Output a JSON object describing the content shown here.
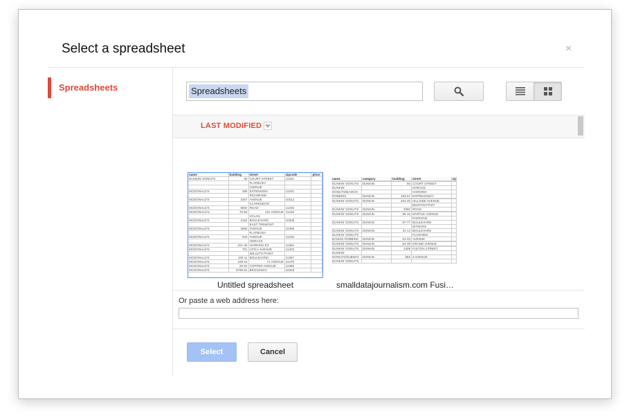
{
  "dialog": {
    "title": "Select a spreadsheet",
    "close_glyph": "×"
  },
  "sidebar": {
    "items": [
      {
        "label": "Spreadsheets",
        "active": true
      }
    ]
  },
  "search": {
    "query_token": "Spreadsheets",
    "search_icon": "magnifier-icon"
  },
  "view_toggle": {
    "list_icon": "list-view-icon",
    "grid_icon": "grid-view-icon",
    "selected": "grid"
  },
  "sort": {
    "label": "LAST MODIFIED",
    "arrow_icon": "dropdown-arrow-icon"
  },
  "files": [
    {
      "name": "Untitled spreadsheet",
      "selected": true,
      "preview": {
        "headers": [
          "name",
          "building",
          "street",
          "zipcode",
          "phon"
        ],
        "rows": [
          [
            "DUNKIN' DONUTS",
            "50",
            "COURT STREET",
            "11201",
            ""
          ],
          [
            "",
            "",
            "FLATBUSH",
            "",
            ""
          ],
          [
            "",
            "",
            "AVENUE",
            "",
            ""
          ],
          [
            "MCDONALD'S",
            "395",
            "EXTENSION",
            "11201",
            ""
          ],
          [
            "",
            "",
            "RICHMOND",
            "",
            ""
          ],
          [
            "MCDONALD'S",
            "3267",
            "AVENUE",
            "10312",
            ""
          ],
          [
            "",
            "",
            "CLARENDON",
            "",
            ""
          ],
          [
            "MCDONALD'S",
            "5804",
            "ROAD",
            "11203",
            ""
          ],
          [
            "MCDONALD'S",
            "75-50",
            "101 AVENUE",
            "11416",
            ""
          ],
          [
            "",
            "",
            "HYLAN",
            "",
            ""
          ],
          [
            "MCDONALD'S",
            "2154",
            "BOULEVARD",
            "10306",
            ""
          ],
          [
            "",
            "",
            "EAST TREMONT",
            "",
            ""
          ],
          [
            "MCDONALD'S",
            "3660",
            "AVENUE",
            "10465",
            ""
          ],
          [
            "",
            "",
            "FLATBUSH",
            "",
            ""
          ],
          [
            "MCDONALD'S",
            "943",
            "AVENUE",
            "11226",
            ""
          ],
          [
            "",
            "",
            "HORACE",
            "",
            ""
          ],
          [
            "MCDONALD'S",
            "221-28",
            "HARDING EX",
            "11364",
            ""
          ],
          [
            "MCDONALD'S",
            "701",
            "UTICA AVENUE",
            "11203",
            ""
          ],
          [
            "",
            "",
            "WILLETS POINT",
            "",
            ""
          ],
          [
            "MCDONALD'S",
            "150-11",
            "BOULEVARD",
            "11357",
            ""
          ],
          [
            "MCDONALD'S",
            "108-15",
            "71 AVENUE",
            "11375",
            ""
          ],
          [
            "MCDONALD'S",
            "20-02",
            "COPPER AVENUE",
            "11385",
            ""
          ],
          [
            "MCDONALD'S",
            "6798-81",
            "BROADWAY",
            "10463",
            ""
          ]
        ]
      }
    },
    {
      "name": "smalldatajournalism.com Fusi…",
      "selected": false,
      "preview": {
        "headers": [
          "name",
          "category",
          "building",
          "street",
          "zip"
        ],
        "rows": [
          [
            "",
            "",
            "",
            "",
            ""
          ],
          [
            "DUNKIN' DONUTS",
            "DUNKIN",
            "56",
            "COURT STREET",
            ""
          ],
          [
            "DUNKIN'",
            "",
            "",
            "HORACE",
            ""
          ],
          [
            "DONUTS/BASKIN",
            "",
            "",
            "HARDING",
            ""
          ],
          [
            "ROBBINS",
            "DUNKIN",
            "183-67",
            "EXPRESSWAY",
            ""
          ],
          [
            "",
            "",
            "",
            "",
            ""
          ],
          [
            "DUNKIN' DONUTS",
            "DUNKIN",
            "254-20",
            "HILLSIDE AVENUE",
            ""
          ],
          [
            "",
            "",
            "",
            "BOSTON POST",
            ""
          ],
          [
            "DUNKIN' DONUTS",
            "DUNKIN",
            "4080",
            "ROAD",
            ""
          ],
          [
            "",
            "",
            "",
            "",
            ""
          ],
          [
            "DUNKIN' DONUTS",
            "DUNKIN",
            "86-16",
            "MYRTLE AVENUE",
            ""
          ],
          [
            "",
            "",
            "",
            "PARSONS",
            ""
          ],
          [
            "DUNKIN' DONUTS",
            "DUNKIN",
            "97-77",
            "BOULEVARD",
            ""
          ],
          [
            "",
            "",
            "",
            "DITMARS",
            ""
          ],
          [
            "DUNKIN' DONUTS",
            "DUNKIN",
            "31-14",
            "BOULEVARD",
            ""
          ],
          [
            "DUNKIN' DONUTS",
            "",
            "",
            "FLUSHING",
            ""
          ],
          [
            "BASKIN ROBBINS",
            "DUNKIN",
            "61-03",
            "AVENUE",
            ""
          ],
          [
            "",
            "",
            "",
            "",
            ""
          ],
          [
            "DUNKIN' DONUTS",
            "DUNKIN",
            "64-38",
            "GRAND AVENUE",
            ""
          ],
          [
            "",
            "",
            "",
            "",
            ""
          ],
          [
            "DUNKIN' DONUTS",
            "DUNKIN",
            "1309",
            "FULTON STREET",
            ""
          ],
          [
            "DUNKIN'",
            "",
            "",
            "",
            ""
          ],
          [
            "DONUTS/SUBWAY",
            "DUNKIN",
            "582",
            "3 AVENUE",
            ""
          ],
          [
            "DUNKIN' DONUTS",
            "",
            "",
            "",
            ""
          ]
        ]
      }
    }
  ],
  "paste": {
    "label": "Or paste a web address here:",
    "value": ""
  },
  "buttons": {
    "select_label": "Select",
    "cancel_label": "Cancel"
  },
  "colors": {
    "accent_red": "#dd4b39",
    "select_blue_disabled": "#a4c2f6",
    "selection_border": "#4d90fe"
  }
}
